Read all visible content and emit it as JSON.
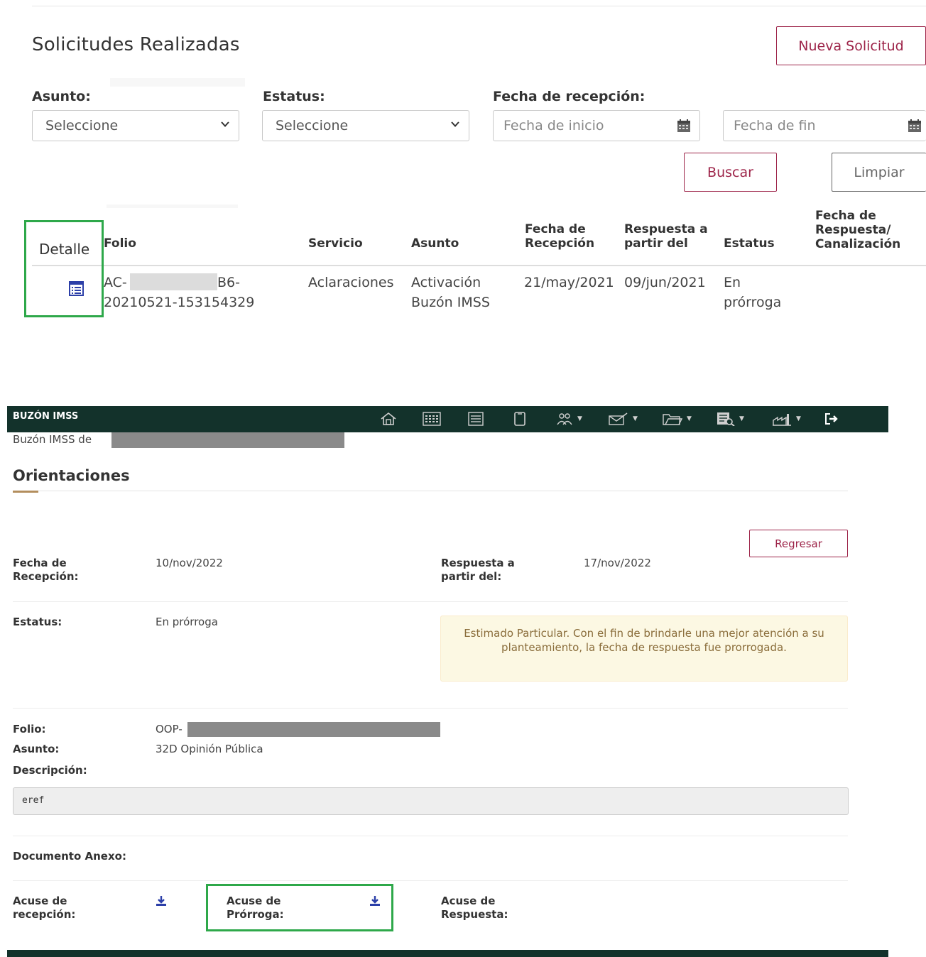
{
  "solicitudes": {
    "title": "Solicitudes Realizadas",
    "new_button": "Nueva Solicitud",
    "filters": {
      "asunto_label": "Asunto:",
      "asunto_value": "Seleccione",
      "estatus_label": "Estatus:",
      "estatus_value": "Seleccione",
      "fecha_label": "Fecha de recepción:",
      "fecha_inicio_placeholder": "Fecha de inicio",
      "fecha_fin_placeholder": "Fecha de fin",
      "search_button": "Buscar",
      "clear_button": "Limpiar"
    },
    "table": {
      "headers": {
        "detalle": "Detalle",
        "folio": "Folio",
        "servicio": "Servicio",
        "asunto": "Asunto",
        "fecha_recepcion_1": "Fecha de",
        "fecha_recepcion_2": "Recepción",
        "respuesta_1": "Respuesta a",
        "respuesta_2": "partir del",
        "estatus": "Estatus",
        "fecha_respuesta_1": "Fecha de",
        "fecha_respuesta_2": "Respuesta/",
        "fecha_respuesta_3": "Canalización"
      },
      "rows": [
        {
          "folio_prefix": "AC-",
          "folio_suffix": "B6-",
          "folio_line2": "20210521-153154329",
          "servicio": "Aclaraciones",
          "asunto_line1": "Activación",
          "asunto_line2": "Buzón IMSS",
          "fecha_recepcion": "21/may/2021",
          "respuesta": "09/jun/2021",
          "estatus_line1": "En",
          "estatus_line2": "prórroga",
          "fecha_respuesta": ""
        }
      ]
    }
  },
  "buzon": {
    "brand": "BUZÓN IMSS",
    "nav_icons": [
      "home-icon",
      "calculator-icon",
      "document-icon",
      "mobile-icon",
      "people-icon",
      "mail-icon",
      "folder-icon",
      "search-document-icon",
      "factory-icon",
      "logout-icon"
    ],
    "buzon_of": "Buzón IMSS de",
    "section_title": "Orientaciones",
    "back_button": "Regresar",
    "fecha_recepcion_label_1": "Fecha de",
    "fecha_recepcion_label_2": "Recepción:",
    "fecha_recepcion_value": "10/nov/2022",
    "respuesta_label_1": "Respuesta a",
    "respuesta_label_2": "partir del:",
    "respuesta_value": "17/nov/2022",
    "estatus_label": "Estatus:",
    "estatus_value": "En prórroga",
    "alert_text": "Estimado Particular. Con el fin de brindarle una mejor atención a su planteamiento, la fecha de respuesta fue prorrogada.",
    "folio_label": "Folio:",
    "folio_value": "OOP-",
    "asunto_label": "Asunto:",
    "asunto_value": "32D Opinión Pública",
    "descripcion_label": "Descripción:",
    "descripcion_value": "eref",
    "documento_label": "Documento Anexo:",
    "acuse_recepcion_1": "Acuse de",
    "acuse_recepcion_2": "recepción:",
    "acuse_prorroga_1": "Acuse de",
    "acuse_prorroga_2": "Prórroga:",
    "acuse_respuesta_1": "Acuse de",
    "acuse_respuesta_2": "Respuesta:"
  },
  "colors": {
    "accent": "#9d2449",
    "navbar": "#13322b",
    "highlight": "#2ea84a",
    "gold": "#b38e5d"
  }
}
